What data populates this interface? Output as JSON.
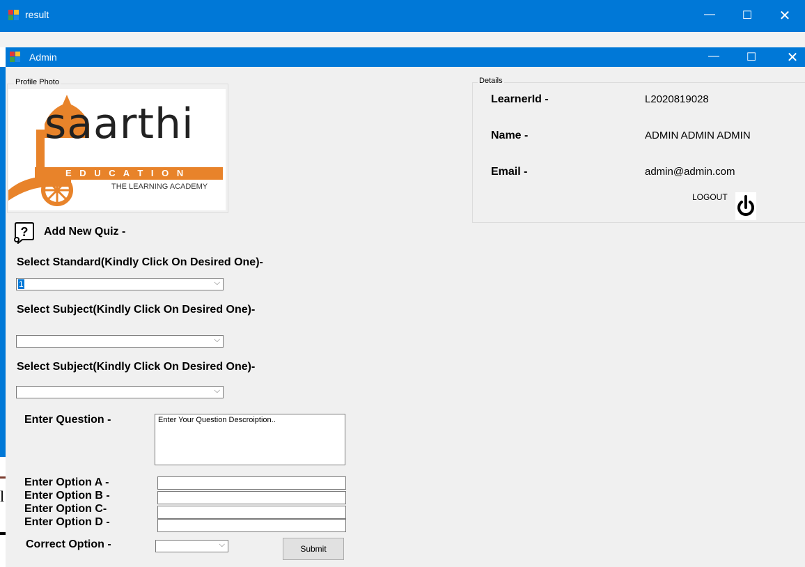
{
  "back_window": {
    "title": "result",
    "background_text": "l"
  },
  "admin_window": {
    "title": "Admin"
  },
  "profile": {
    "group_title": "Profile Photo",
    "logo_word": "saarthi",
    "logo_education": "E D U C A T I O N",
    "logo_tagline": "THE LEARNING ACADEMY"
  },
  "details": {
    "group_title": "Details",
    "learner_label": "LearnerId -",
    "learner_value": "L2020819028",
    "name_label": "Name -",
    "name_value": "ADMIN ADMIN ADMIN",
    "email_label": "Email -",
    "email_value": "admin@admin.com",
    "logout_label": "LOGOUT"
  },
  "quiz": {
    "heading": "Add New Quiz  -",
    "standard_label": "Select Standard(Kindly Click On Desired One)-",
    "standard_value": "1",
    "subject_label": "Select Subject(Kindly Click On Desired One)-",
    "subject_value": "",
    "subject2_label": "Select Subject(Kindly Click On Desired One)-",
    "subject2_value": "",
    "question_label": "Enter Question -",
    "question_placeholder": "Enter Your Question Descroiption..",
    "option_a_label": "Enter Option A -",
    "option_b_label": "Enter Option B -",
    "option_c_label": "Enter Option C-",
    "option_d_label": "Enter Option D -",
    "correct_label": "Correct Option -",
    "submit_label": "Submit"
  },
  "colors": {
    "titlebar": "#0078d7",
    "logo_orange": "#e8832a",
    "client_bg": "#f0f0f0"
  }
}
